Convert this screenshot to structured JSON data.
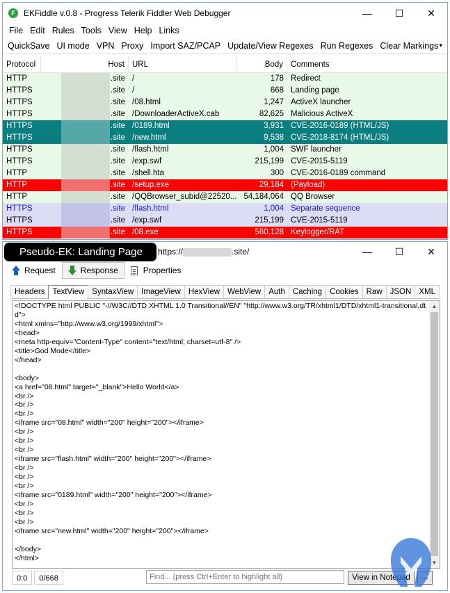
{
  "window": {
    "title": "EKFiddle v.0.8 - Progress Telerik Fiddler Web Debugger",
    "minimize": "—",
    "maximize": "☐",
    "close": "✕"
  },
  "menu": [
    "File",
    "Edit",
    "Rules",
    "Tools",
    "View",
    "Help",
    "Links"
  ],
  "toolbar": [
    "QuickSave",
    "UI mode",
    "VPN",
    "Proxy",
    "Import SAZ/PCAP",
    "Update/View Regexes",
    "Run Regexes",
    "Clear Markings"
  ],
  "toolbar_overflow": "▾",
  "sessions": {
    "columns": {
      "protocol": "Protocol",
      "host": "Host",
      "url": "URL",
      "body": "Body",
      "comments": "Comments"
    },
    "rows": [
      {
        "protocol": "HTTP",
        "host": ".site",
        "url": "/",
        "body": "178",
        "comment": "Redirect",
        "bg": "#e9f9e7",
        "fg": "#000000"
      },
      {
        "protocol": "HTTPS",
        "host": ".site",
        "url": "/",
        "body": "668",
        "comment": "Landing page",
        "bg": "#e9f9e7",
        "fg": "#000000"
      },
      {
        "protocol": "HTTPS",
        "host": ".site",
        "url": "/08.html",
        "body": "1,247",
        "comment": "ActiveX launcher",
        "bg": "#e9f9e7",
        "fg": "#000000"
      },
      {
        "protocol": "HTTPS",
        "host": ".site",
        "url": "/DownloaderActiveX.cab",
        "body": "82,625",
        "comment": "Malicious ActiveX",
        "bg": "#e9f9e7",
        "fg": "#000000"
      },
      {
        "protocol": "HTTPS",
        "host": ".site",
        "url": "/0189.html",
        "body": "3,931",
        "comment": "CVE-2016-0189 (HTML/JS)",
        "bg": "#0b7f7f",
        "fg": "#ffffff"
      },
      {
        "protocol": "HTTPS",
        "host": ".site",
        "url": "/new.html",
        "body": "9,538",
        "comment": "CVE-2018-8174 (HTML/JS)",
        "bg": "#0b7f7f",
        "fg": "#ffffff"
      },
      {
        "protocol": "HTTPS",
        "host": ".site",
        "url": "/flash.html",
        "body": "1,004",
        "comment": "SWF launcher",
        "bg": "#e9f9e7",
        "fg": "#000000"
      },
      {
        "protocol": "HTTPS",
        "host": ".site",
        "url": "/exp.swf",
        "body": "215,199",
        "comment": "CVE-2015-5119",
        "bg": "#e9f9e7",
        "fg": "#000000"
      },
      {
        "protocol": "HTTP",
        "host": ".site",
        "url": "/shell.hta",
        "body": "300",
        "comment": "CVE-2016-0189 command",
        "bg": "#e9f9e7",
        "fg": "#000000"
      },
      {
        "protocol": "HTTP",
        "host": ".site",
        "url": "/setup.exe",
        "body": "29,184",
        "comment": "(Payload)",
        "bg": "#ff0000",
        "fg": "#ffffff"
      },
      {
        "protocol": "HTTP",
        "host": ".site",
        "url": "/QQBrowser_subid@22520...",
        "body": "54,184,064",
        "comment": "QQ Browser",
        "bg": "#e9f9e7",
        "fg": "#000000"
      },
      {
        "protocol": "HTTPS",
        "host": ".site",
        "url": "/flash.html",
        "body": "1,004",
        "comment": "Separate sequence",
        "bg": "#dcdcf4",
        "fg": "#1a1adc"
      },
      {
        "protocol": "HTTPS",
        "host": ".site",
        "url": "/exp.swf",
        "body": "215,199",
        "comment": "CVE-2015-5119",
        "bg": "#dcdcf4",
        "fg": "#000000"
      },
      {
        "protocol": "HTTPS",
        "host": ".site",
        "url": "/08.exe",
        "body": "560,128",
        "comment": "Keylogger/RAT",
        "bg": "#ff0000",
        "fg": "#ffffff"
      }
    ]
  },
  "pane": {
    "badge": "Pseudo-EK: Landing Page",
    "url_prefix": "https://",
    "url_suffix": ".site/",
    "tabs": {
      "request": "Request",
      "response": "Response",
      "properties": "Properties"
    },
    "inspectors": [
      "Headers",
      "TextView",
      "SyntaxView",
      "ImageView",
      "HexView",
      "WebView",
      "Auth",
      "Caching",
      "Cookies",
      "Raw",
      "JSON",
      "XML"
    ],
    "code": "<!DOCTYPE html PUBLIC \"-//W3C//DTD XHTML 1.0 Transitional//EN\" \"http://www.w3.org/TR/xhtml1/DTD/xhtml1-transitional.dtd\">\n<html xmlns=\"http://www.w3.org/1999/xhtml\">\n<head>\n<meta http-equiv=\"Content-Type\" content=\"text/html; charset=utf-8\" />\n<title>God Mode</title>\n</head>\n\n<body>\n<a href=\"08.html\" target=\"_blank\">Hello World</a>\n<br />\n<br />\n<br />\n<iframe src=\"08.html\" width=\"200\" height=\"200\"></iframe>\n<br />\n<br />\n<br />\n<iframe src=\"flash.html\" width=\"200\" height=\"200\"></iframe>\n<br />\n<br />\n<br />\n<iframe src=\"0189.html\" width=\"200\" height=\"200\"></iframe>\n<br />\n<br />\n<br />\n<iframe src=\"new.html\" width=\"200\" height=\"200\"></iframe>\n\n</body>\n</html>",
    "status": {
      "cursor": "0:0",
      "size": "0/668"
    },
    "find_placeholder": "Find... (press Ctrl+Enter to highlight all)",
    "view_in_notepad": "View in Notepad",
    "more": "..."
  },
  "colors": {
    "accent_blue": "#1f5fbf",
    "malwarebytes_blue": "#2b6fd6"
  }
}
